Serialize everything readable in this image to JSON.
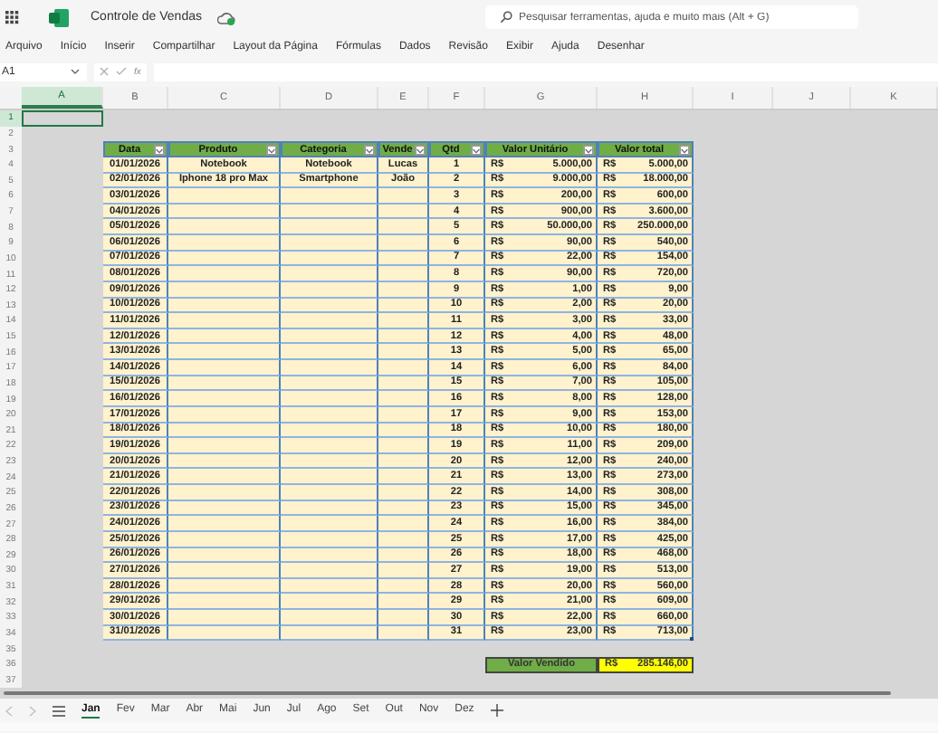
{
  "app": {
    "title": "Controle de Vendas",
    "search_placeholder": "Pesquisar ferramentas, ajuda e muito mais (Alt + G)"
  },
  "menu": [
    "Arquivo",
    "Início",
    "Inserir",
    "Compartilhar",
    "Layout da Página",
    "Fórmulas",
    "Dados",
    "Revisão",
    "Exibir",
    "Ajuda",
    "Desenhar"
  ],
  "formula_bar": {
    "name_box": "A1",
    "function_label": "fx"
  },
  "column_headers": [
    {
      "label": "A",
      "selected": true
    },
    {
      "label": "B",
      "selected": false
    },
    {
      "label": "C",
      "selected": false
    },
    {
      "label": "D",
      "selected": false
    },
    {
      "label": "E",
      "selected": false
    },
    {
      "label": "F",
      "selected": false
    },
    {
      "label": "G",
      "selected": false
    },
    {
      "label": "H",
      "selected": false
    },
    {
      "label": "I",
      "selected": false
    },
    {
      "label": "J",
      "selected": false
    },
    {
      "label": "K",
      "selected": false
    }
  ],
  "row_numbers": [
    {
      "label": "1",
      "selected": true
    },
    {
      "label": "2",
      "selected": false
    },
    {
      "label": "3",
      "selected": false
    },
    {
      "label": "4",
      "selected": false
    },
    {
      "label": "5",
      "selected": false
    },
    {
      "label": "6",
      "selected": false
    },
    {
      "label": "7",
      "selected": false
    },
    {
      "label": "8",
      "selected": false
    },
    {
      "label": "9",
      "selected": false
    },
    {
      "label": "10",
      "selected": false
    },
    {
      "label": "11",
      "selected": false
    },
    {
      "label": "12",
      "selected": false
    },
    {
      "label": "13",
      "selected": false
    },
    {
      "label": "14",
      "selected": false
    },
    {
      "label": "15",
      "selected": false
    },
    {
      "label": "16",
      "selected": false
    },
    {
      "label": "17",
      "selected": false
    },
    {
      "label": "18",
      "selected": false
    },
    {
      "label": "19",
      "selected": false
    },
    {
      "label": "20",
      "selected": false
    },
    {
      "label": "21",
      "selected": false
    },
    {
      "label": "22",
      "selected": false
    },
    {
      "label": "23",
      "selected": false
    },
    {
      "label": "24",
      "selected": false
    },
    {
      "label": "25",
      "selected": false
    },
    {
      "label": "26",
      "selected": false
    },
    {
      "label": "27",
      "selected": false
    },
    {
      "label": "28",
      "selected": false
    },
    {
      "label": "29",
      "selected": false
    },
    {
      "label": "30",
      "selected": false
    },
    {
      "label": "31",
      "selected": false
    },
    {
      "label": "32",
      "selected": false
    },
    {
      "label": "33",
      "selected": false
    },
    {
      "label": "34",
      "selected": false
    },
    {
      "label": "35",
      "selected": false
    },
    {
      "label": "36",
      "selected": false
    },
    {
      "label": "37",
      "selected": false
    }
  ],
  "table": {
    "columns": [
      "Data",
      "Produto",
      "Categoria",
      "Vende",
      "Qtd",
      "Valor Unitário",
      "Valor total"
    ],
    "rows": [
      {
        "date": "01/01/2026",
        "product": "Notebook",
        "category": "Notebook",
        "seller": "Lucas",
        "qty": "1",
        "unit_currency": "R$",
        "unit_price": "5.000,00",
        "total_currency": "R$",
        "total": "5.000,00"
      },
      {
        "date": "02/01/2026",
        "product": "Iphone 18 pro Max",
        "category": "Smartphone",
        "seller": "João",
        "qty": "2",
        "unit_currency": "R$",
        "unit_price": "9.000,00",
        "total_currency": "R$",
        "total": "18.000,00"
      },
      {
        "date": "03/01/2026",
        "qty": "3",
        "unit_currency": "R$",
        "unit_price": "200,00",
        "total_currency": "R$",
        "total": "600,00"
      },
      {
        "date": "04/01/2026",
        "qty": "4",
        "unit_currency": "R$",
        "unit_price": "900,00",
        "total_currency": "R$",
        "total": "3.600,00"
      },
      {
        "date": "05/01/2026",
        "qty": "5",
        "unit_currency": "R$",
        "unit_price": "50.000,00",
        "total_currency": "R$",
        "total": "250.000,00"
      },
      {
        "date": "06/01/2026",
        "qty": "6",
        "unit_currency": "R$",
        "unit_price": "90,00",
        "total_currency": "R$",
        "total": "540,00"
      },
      {
        "date": "07/01/2026",
        "qty": "7",
        "unit_currency": "R$",
        "unit_price": "22,00",
        "total_currency": "R$",
        "total": "154,00"
      },
      {
        "date": "08/01/2026",
        "qty": "8",
        "unit_currency": "R$",
        "unit_price": "90,00",
        "total_currency": "R$",
        "total": "720,00"
      },
      {
        "date": "09/01/2026",
        "qty": "9",
        "unit_currency": "R$",
        "unit_price": "1,00",
        "total_currency": "R$",
        "total": "9,00"
      },
      {
        "date": "10/01/2026",
        "qty": "10",
        "unit_currency": "R$",
        "unit_price": "2,00",
        "total_currency": "R$",
        "total": "20,00"
      },
      {
        "date": "11/01/2026",
        "qty": "11",
        "unit_currency": "R$",
        "unit_price": "3,00",
        "total_currency": "R$",
        "total": "33,00"
      },
      {
        "date": "12/01/2026",
        "qty": "12",
        "unit_currency": "R$",
        "unit_price": "4,00",
        "total_currency": "R$",
        "total": "48,00"
      },
      {
        "date": "13/01/2026",
        "qty": "13",
        "unit_currency": "R$",
        "unit_price": "5,00",
        "total_currency": "R$",
        "total": "65,00"
      },
      {
        "date": "14/01/2026",
        "qty": "14",
        "unit_currency": "R$",
        "unit_price": "6,00",
        "total_currency": "R$",
        "total": "84,00"
      },
      {
        "date": "15/01/2026",
        "qty": "15",
        "unit_currency": "R$",
        "unit_price": "7,00",
        "total_currency": "R$",
        "total": "105,00"
      },
      {
        "date": "16/01/2026",
        "qty": "16",
        "unit_currency": "R$",
        "unit_price": "8,00",
        "total_currency": "R$",
        "total": "128,00"
      },
      {
        "date": "17/01/2026",
        "qty": "17",
        "unit_currency": "R$",
        "unit_price": "9,00",
        "total_currency": "R$",
        "total": "153,00"
      },
      {
        "date": "18/01/2026",
        "qty": "18",
        "unit_currency": "R$",
        "unit_price": "10,00",
        "total_currency": "R$",
        "total": "180,00"
      },
      {
        "date": "19/01/2026",
        "qty": "19",
        "unit_currency": "R$",
        "unit_price": "11,00",
        "total_currency": "R$",
        "total": "209,00"
      },
      {
        "date": "20/01/2026",
        "qty": "20",
        "unit_currency": "R$",
        "unit_price": "12,00",
        "total_currency": "R$",
        "total": "240,00"
      },
      {
        "date": "21/01/2026",
        "qty": "21",
        "unit_currency": "R$",
        "unit_price": "13,00",
        "total_currency": "R$",
        "total": "273,00"
      },
      {
        "date": "22/01/2026",
        "qty": "22",
        "unit_currency": "R$",
        "unit_price": "14,00",
        "total_currency": "R$",
        "total": "308,00"
      },
      {
        "date": "23/01/2026",
        "qty": "23",
        "unit_currency": "R$",
        "unit_price": "15,00",
        "total_currency": "R$",
        "total": "345,00"
      },
      {
        "date": "24/01/2026",
        "qty": "24",
        "unit_currency": "R$",
        "unit_price": "16,00",
        "total_currency": "R$",
        "total": "384,00"
      },
      {
        "date": "25/01/2026",
        "qty": "25",
        "unit_currency": "R$",
        "unit_price": "17,00",
        "total_currency": "R$",
        "total": "425,00"
      },
      {
        "date": "26/01/2026",
        "qty": "26",
        "unit_currency": "R$",
        "unit_price": "18,00",
        "total_currency": "R$",
        "total": "468,00"
      },
      {
        "date": "27/01/2026",
        "qty": "27",
        "unit_currency": "R$",
        "unit_price": "19,00",
        "total_currency": "R$",
        "total": "513,00"
      },
      {
        "date": "28/01/2026",
        "qty": "28",
        "unit_currency": "R$",
        "unit_price": "20,00",
        "total_currency": "R$",
        "total": "560,00"
      },
      {
        "date": "29/01/2026",
        "qty": "29",
        "unit_currency": "R$",
        "unit_price": "21,00",
        "total_currency": "R$",
        "total": "609,00"
      },
      {
        "date": "30/01/2026",
        "qty": "30",
        "unit_currency": "R$",
        "unit_price": "22,00",
        "total_currency": "R$",
        "total": "660,00"
      },
      {
        "date": "31/01/2026",
        "qty": "31",
        "unit_currency": "R$",
        "unit_price": "23,00",
        "total_currency": "R$",
        "total": "713,00"
      }
    ]
  },
  "summary": {
    "label": "Valor Vendido",
    "currency": "R$",
    "value": "285.146,00"
  },
  "sheet_tabs": [
    {
      "label": "Jan",
      "selected": true
    },
    {
      "label": "Fev",
      "selected": false
    },
    {
      "label": "Mar",
      "selected": false
    },
    {
      "label": "Abr",
      "selected": false
    },
    {
      "label": "Mai",
      "selected": false
    },
    {
      "label": "Jun",
      "selected": false
    },
    {
      "label": "Jul",
      "selected": false
    },
    {
      "label": "Ago",
      "selected": false
    },
    {
      "label": "Set",
      "selected": false
    },
    {
      "label": "Out",
      "selected": false
    },
    {
      "label": "Nov",
      "selected": false
    },
    {
      "label": "Dez",
      "selected": false
    }
  ]
}
